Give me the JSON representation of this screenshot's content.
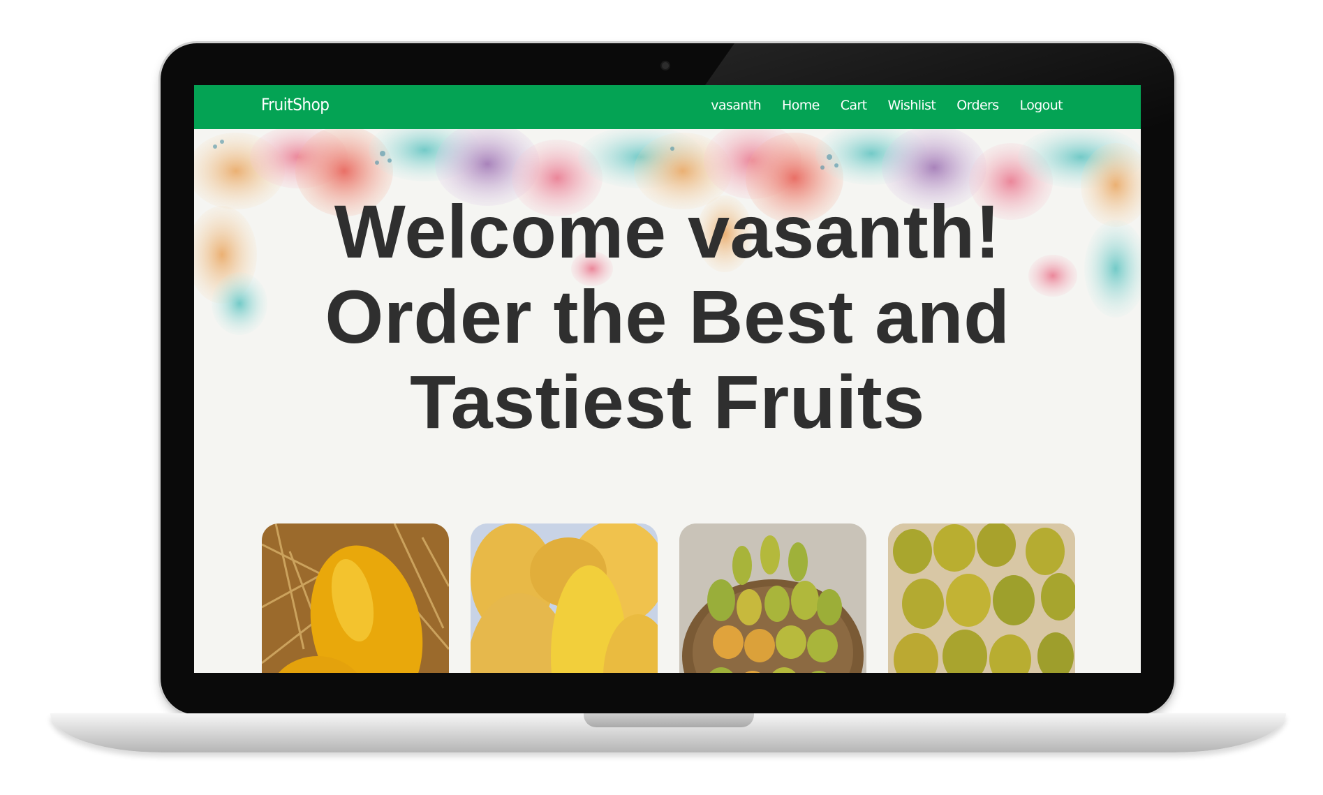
{
  "navbar": {
    "brand": "FruitShop",
    "items": [
      {
        "label": "vasanth"
      },
      {
        "label": "Home"
      },
      {
        "label": "Cart"
      },
      {
        "label": "Wishlist"
      },
      {
        "label": "Orders"
      },
      {
        "label": "Logout"
      }
    ]
  },
  "hero": {
    "headline": "Welcome vasanth! Order the Best and Tastiest Fruits"
  },
  "products": [
    {
      "image": "yellow-mango-on-straw"
    },
    {
      "image": "cut-yellow-mangoes"
    },
    {
      "image": "mango-basket"
    },
    {
      "image": "mango-crate"
    }
  ],
  "colors": {
    "navbar_bg": "#04a354",
    "nav_text": "#ffffff",
    "headline": "#2f2f2f",
    "page_bg": "#f5f5f2"
  }
}
